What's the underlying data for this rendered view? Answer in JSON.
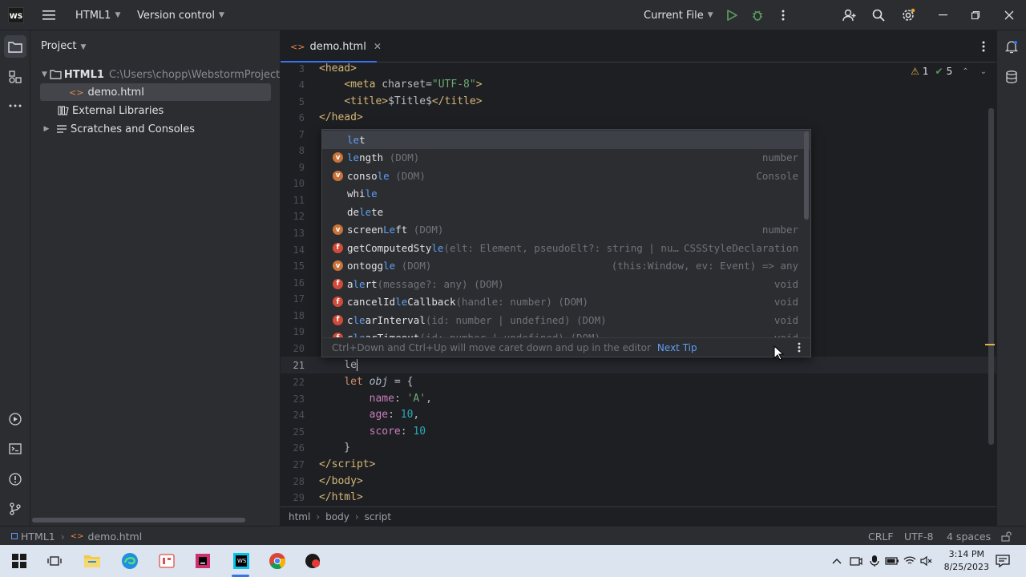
{
  "titlebar": {
    "project": "HTML1",
    "vcs": "Version control",
    "run_config": "Current File"
  },
  "project_panel": {
    "header": "Project",
    "root_name": "HTML1",
    "root_path": "C:\\Users\\chopp\\WebstormProjects\\H",
    "file": "demo.html",
    "external": "External Libraries",
    "scratches": "Scratches and Consoles"
  },
  "editor": {
    "tab": "demo.html",
    "warnings": "1",
    "checks": "5",
    "lines": [
      "3",
      "4",
      "5",
      "6",
      "7",
      "8",
      "9",
      "10",
      "11",
      "12",
      "13",
      "14",
      "15",
      "16",
      "17",
      "18",
      "19",
      "20",
      "21",
      "22",
      "23",
      "24",
      "25",
      "26",
      "27",
      "28",
      "29"
    ],
    "typed": "le",
    "breadcrumbs": [
      "html",
      "body",
      "script"
    ]
  },
  "completion": {
    "items": [
      {
        "name_pre": "",
        "hl": "le",
        "name_post": "t",
        "detail": "",
        "type": "",
        "kind": ""
      },
      {
        "name_pre": "",
        "hl": "le",
        "name_post": "ngth",
        "detail": " (DOM)",
        "type": "number",
        "kind": "v"
      },
      {
        "name_pre": "conso",
        "hl": "le",
        "name_post": "",
        "detail": " (DOM)",
        "type": "Console",
        "kind": "v"
      },
      {
        "name_pre": "whi",
        "hl": "le",
        "name_post": "",
        "detail": "",
        "type": "",
        "kind": ""
      },
      {
        "name_pre": "de",
        "hl": "le",
        "name_post": "te",
        "detail": "",
        "type": "",
        "kind": ""
      },
      {
        "name_pre": "screen",
        "hl": "Le",
        "name_post": "ft",
        "detail": " (DOM)",
        "type": "number",
        "kind": "v"
      },
      {
        "name_pre": "getComputedSty",
        "hl": "le",
        "name_post": "",
        "detail": "(elt: Element, pseudoElt?: string | nu…",
        "type": "CSSStyleDeclaration",
        "kind": "f"
      },
      {
        "name_pre": "ontogg",
        "hl": "le",
        "name_post": "",
        "detail": " (DOM)",
        "type": "(this:Window, ev: Event) => any",
        "kind": "v"
      },
      {
        "name_pre": "a",
        "hl": "le",
        "name_post": "rt",
        "detail": "(message?: any) (DOM)",
        "type": "void",
        "kind": "f"
      },
      {
        "name_pre": "cancelId",
        "hl": "le",
        "name_post": "Callback",
        "detail": "(handle: number) (DOM)",
        "type": "void",
        "kind": "f"
      },
      {
        "name_pre": "c",
        "hl": "le",
        "name_post": "arInterval",
        "detail": "(id: number | undefined) (DOM)",
        "type": "void",
        "kind": "f"
      },
      {
        "name_pre": "c",
        "hl": "le",
        "name_post": "arTimeout",
        "detail": "(id: number | undefined) (DOM)",
        "type": "void",
        "kind": "f"
      }
    ],
    "tip": "Ctrl+Down and Ctrl+Up will move caret down and up in the editor",
    "next_tip": "Next Tip"
  },
  "statusbar": {
    "project": "HTML1",
    "file": "demo.html",
    "line_sep": "CRLF",
    "encoding": "UTF-8",
    "indent": "4 spaces"
  },
  "taskbar": {
    "time": "3:14 PM",
    "date": "8/25/2023"
  },
  "colors": {
    "accent": "#3574f0",
    "background": "#1e1f22",
    "panel": "#2b2d30"
  }
}
